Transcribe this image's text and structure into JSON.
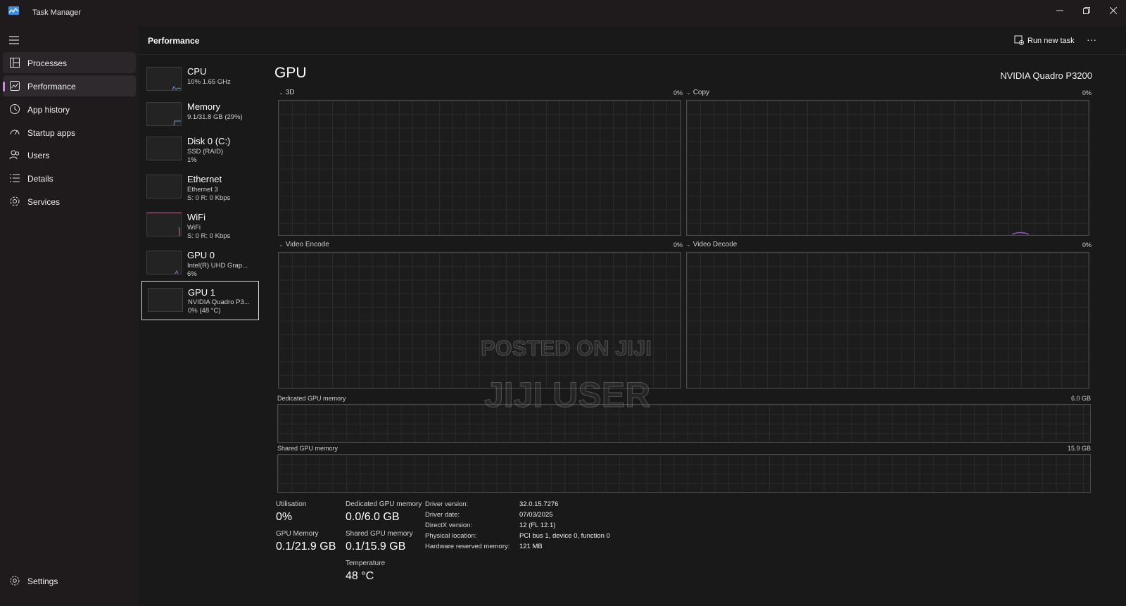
{
  "window": {
    "title": "Task Manager",
    "controls": [
      "minimize",
      "restore",
      "close"
    ]
  },
  "nav": {
    "items": [
      {
        "label": "Processes",
        "icon": "processes-icon"
      },
      {
        "label": "Performance",
        "icon": "performance-icon"
      },
      {
        "label": "App history",
        "icon": "history-icon"
      },
      {
        "label": "Startup apps",
        "icon": "startup-icon"
      },
      {
        "label": "Users",
        "icon": "users-icon"
      },
      {
        "label": "Details",
        "icon": "details-icon"
      },
      {
        "label": "Services",
        "icon": "services-icon"
      }
    ],
    "settings_label": "Settings",
    "active": "Performance"
  },
  "header": {
    "title": "Performance",
    "run_task_label": "Run new task",
    "more_label": "···"
  },
  "devices": [
    {
      "name": "CPU",
      "line1": "10%  1.65 GHz",
      "line2": ""
    },
    {
      "name": "Memory",
      "line1": "9.1/31.8 GB (29%)",
      "line2": ""
    },
    {
      "name": "Disk 0 (C:)",
      "line1": "SSD (RAID)",
      "line2": "1%"
    },
    {
      "name": "Ethernet",
      "line1": "Ethernet 3",
      "line2": "S: 0  R: 0 Kbps"
    },
    {
      "name": "WiFi",
      "line1": "WiFi",
      "line2": "S: 0  R: 0 Kbps"
    },
    {
      "name": "GPU 0",
      "line1": "Intel(R) UHD Grap...",
      "line2": "6%"
    },
    {
      "name": "GPU 1",
      "line1": "NVIDIA Quadro P3...",
      "line2": "0%  (48 °C)"
    }
  ],
  "gpu": {
    "title": "GPU",
    "model": "NVIDIA Quadro P3200",
    "engines": [
      {
        "label": "3D",
        "percent": "0%"
      },
      {
        "label": "Copy",
        "percent": "0%"
      },
      {
        "label": "Video Encode",
        "percent": "0%"
      },
      {
        "label": "Video Decode",
        "percent": "0%"
      }
    ],
    "dedicated_label": "Dedicated GPU memory",
    "dedicated_max": "6.0 GB",
    "shared_label": "Shared GPU memory",
    "shared_max": "15.9 GB"
  },
  "stats": {
    "utilisation_label": "Utilisation",
    "utilisation_value": "0%",
    "dedicated_label": "Dedicated GPU memory",
    "dedicated_value": "0.0/6.0 GB",
    "gpu_memory_label": "GPU Memory",
    "gpu_memory_value": "0.1/21.9 GB",
    "shared_label": "Shared GPU memory",
    "shared_value": "0.1/15.9 GB",
    "temperature_label": "Temperature",
    "temperature_value": "48 °C"
  },
  "info": {
    "driver_version_label": "Driver version:",
    "driver_version": "32.0.15.7276",
    "driver_date_label": "Driver date:",
    "driver_date": "07/03/2025",
    "directx_label": "DirectX version:",
    "directx": "12 (FL 12.1)",
    "location_label": "Physical location:",
    "location": "PCI bus 1, device 0, function 0",
    "reserved_label": "Hardware reserved memory:",
    "reserved": "121 MB"
  },
  "watermark": {
    "line1": "POSTED ON JIJI",
    "line2": "JIJI USER"
  }
}
